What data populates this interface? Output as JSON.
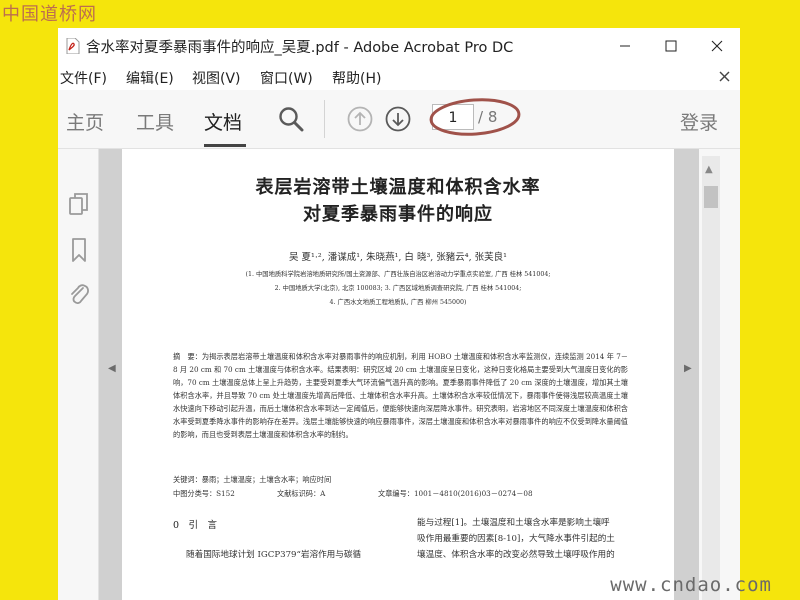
{
  "watermark": {
    "top": "中国道桥网",
    "bottom": "www.cndao.com"
  },
  "window": {
    "title": "含水率对夏季暴雨事件的响应_吴夏.pdf - Adobe Acrobat Pro DC",
    "controls": [
      "minimize-icon",
      "maximize-icon",
      "close-icon"
    ]
  },
  "menu": {
    "items": [
      {
        "id": "file",
        "label": "文件(F)"
      },
      {
        "id": "edit",
        "label": "编辑(E)"
      },
      {
        "id": "view",
        "label": "视图(V)"
      },
      {
        "id": "window",
        "label": "窗口(W)"
      },
      {
        "id": "help",
        "label": "帮助(H)"
      }
    ]
  },
  "toolbar": {
    "tabs": [
      {
        "id": "home",
        "label": "主页",
        "active": false
      },
      {
        "id": "tools",
        "label": "工具",
        "active": false
      },
      {
        "id": "document",
        "label": "文档",
        "active": true
      }
    ],
    "current_page": "1",
    "total_pages": "/ 8",
    "login_label": "登录",
    "icons": [
      "search-icon",
      "page-up-icon",
      "page-down-icon"
    ],
    "annotation_color": "#a0524a"
  },
  "left_panel": {
    "icons": [
      "copy-pages-icon",
      "bookmark-icon",
      "attachment-icon"
    ]
  },
  "paper": {
    "title_line1": "表层岩溶带土壤温度和体积含水率",
    "title_line2": "对夏季暴雨事件的响应",
    "authors": "吴 夏¹·², 潘谋成¹, 朱晓燕¹, 白 晓³, 张豬云⁴, 张芙良¹",
    "affiliations": [
      "(1. 中国地质科学院岩溶地质研究所/国土资源部、广西壮族自治区岩溶动力学重点实验室, 广西 桂林 541004;",
      "2. 中国地质大学(北京), 北京 100083; 3. 广西区域地质调查研究院, 广西 桂林 541004;",
      "4. 广西水文地质工程地质队, 广西 柳州 545000)"
    ],
    "abstract": "摘　要：为揭示表层岩溶带土壤温度和体积含水率对暴雨事件的响应机制，利用 HOBO 土壤温度和体积含水率监测仪，连续监测 2014 年 7－8 月 20 cm 和 70 cm 土壤温度与体积含水率。结果表明：研究区域 20 cm 土壤温度呈日变化，这种日变化格局主要受到大气温度日变化的影响，70 cm 土壤温度总体上呈上升趋势，主要受到夏季大气环流偏气温升高的影响。夏季暴雨事件降低了 20 cm 深度的土壤温度，增加其土壤体积含水率，并且导致 70 cm 处土壤温度先增高后降低、土壤体积含水率升高。土壤体积含水率较低情况下，暴雨事件使得浅层较高温度土壤水快速向下移动引起升温，而后土壤体积含水率到达一定阈值后，便能够快速向深层降水事件。研究表明，岩溶地区不同深度土壤温度和体积含水率受到夏季降水事件的影响存在差异。浅层土壤能够快速的响应暴雨事件，深层土壤温度和体积含水率对暴雨事件的响应不仅受到降水量阈值的影响，而且也受到表层土壤温度和体积含水率的制约。",
    "keywords": "关键词：暴雨；土壤温度；土壤含水率；响应时间",
    "class_no": "中图分类号：S152",
    "doc_code": "文献标识码：A",
    "article_no": "文章编号：1001－4810(2016)03－0274－08",
    "section_heading": "0　引　言",
    "right_col": [
      "能与过程[1]。土壤温度和土壤含水率是影响土壤呼",
      "吸作用最重要的因素[8-10]，大气降水事件引起的土",
      "壤温度、体积含水率的改变必然导致土壤呼吸作用的"
    ],
    "left_col": [
      "随着国际地球计划 IGCP379“岩溶作用与碳循"
    ]
  }
}
